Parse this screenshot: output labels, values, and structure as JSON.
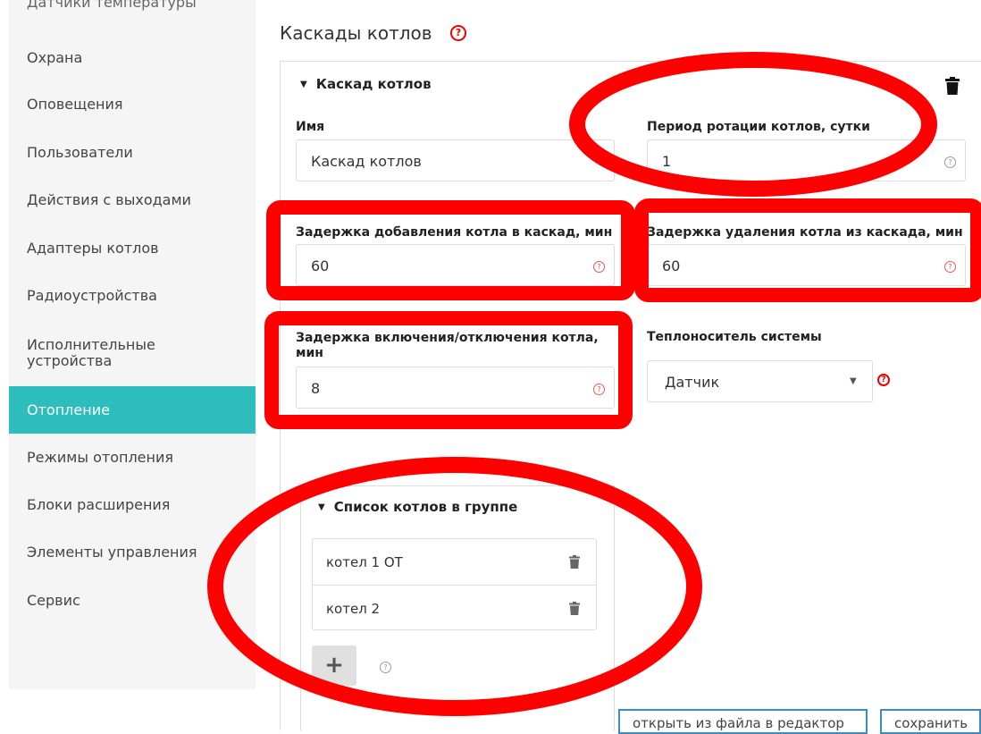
{
  "sidebar": {
    "items": [
      {
        "label": "Датчики температуры"
      },
      {
        "label": "Охрана"
      },
      {
        "label": "Оповещения"
      },
      {
        "label": "Пользователи"
      },
      {
        "label": "Действия с выходами"
      },
      {
        "label": "Адаптеры котлов"
      },
      {
        "label": "Радиоустройства"
      },
      {
        "label": "Исполнительные устройства"
      },
      {
        "label": "Отопление"
      },
      {
        "label": "Режимы отопления"
      },
      {
        "label": "Блоки расширения"
      },
      {
        "label": "Элементы управления"
      },
      {
        "label": "Сервис"
      }
    ],
    "active": "Отопление"
  },
  "main": {
    "title": "Каскады котлов",
    "panel_title": "Каскад котлов",
    "name_label": "Имя",
    "name_value": "Каскад котлов",
    "rotation_label": "Период ротации котлов, сутки",
    "rotation_value": "1",
    "add_delay_label": "Задержка добавления котла в каскад, мин",
    "add_delay_value": "60",
    "remove_delay_label": "Задержка удаления котла из каскада, мин",
    "remove_delay_value": "60",
    "onoff_delay_label": "Задержка включения/отключения котла, мин",
    "onoff_delay_value": "8",
    "coolant_label": "Теплоноситель системы",
    "coolant_value": "Датчик",
    "list_title": "Список котлов в группе",
    "boilers": [
      {
        "label": "котел 1 ОТ"
      },
      {
        "label": "котел 2"
      }
    ]
  },
  "footer": {
    "open_editor_label": "открыть из файла в редактор",
    "save_label": "сохранить"
  },
  "icons": {
    "help": "question-circle-icon",
    "trash": "trash-icon",
    "plus": "plus-icon",
    "caret": "caret-down-icon"
  },
  "colors": {
    "active_item": "#2ebdbd",
    "annotation": "#ff0000",
    "button_border": "#3b8cc6"
  }
}
